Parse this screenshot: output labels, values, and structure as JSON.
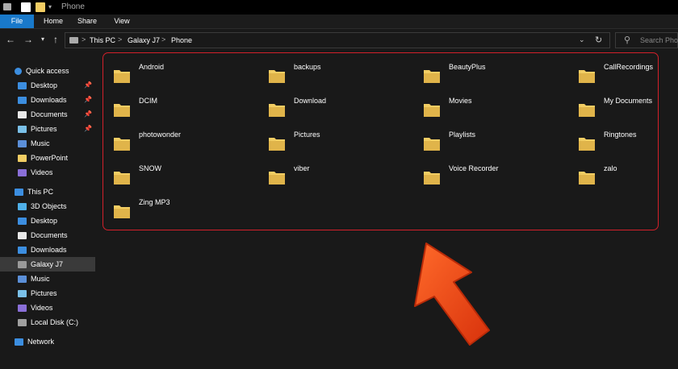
{
  "window": {
    "title": "Phone"
  },
  "ribbon": {
    "tabs": [
      "File",
      "Home",
      "Share",
      "View"
    ]
  },
  "address": {
    "crumbs": [
      "This PC",
      "Galaxy J7",
      "Phone"
    ],
    "separator": ">"
  },
  "search": {
    "placeholder": "Search Phone"
  },
  "sidebar": {
    "quick_access": "Quick access",
    "quick_items": [
      "Desktop",
      "Downloads",
      "Documents",
      "Pictures",
      "Music",
      "PowerPoint",
      "Videos"
    ],
    "this_pc": "This PC",
    "pc_items": [
      "3D Objects",
      "Desktop",
      "Documents",
      "Downloads",
      "Galaxy J7",
      "Music",
      "Pictures",
      "Videos",
      "Local Disk (C:)"
    ],
    "network": "Network",
    "selected": "Galaxy J7"
  },
  "folders": [
    "Android",
    "backups",
    "BeautyPlus",
    "CallRecordings",
    "DCIM",
    "Download",
    "Movies",
    "My Documents",
    "photowonder",
    "Pictures",
    "Playlists",
    "Ringtones",
    "SNOW",
    "viber",
    "Voice Recorder",
    "zalo",
    "Zing MP3"
  ],
  "colors": {
    "accent": "#1979ca",
    "highlight": "#d3202a",
    "folder": "#f2cd63",
    "arrow": "#f04a1a"
  },
  "icons": {
    "folder": "folder-icon",
    "pin": "pin-icon",
    "arrow": "pointer-arrow"
  }
}
